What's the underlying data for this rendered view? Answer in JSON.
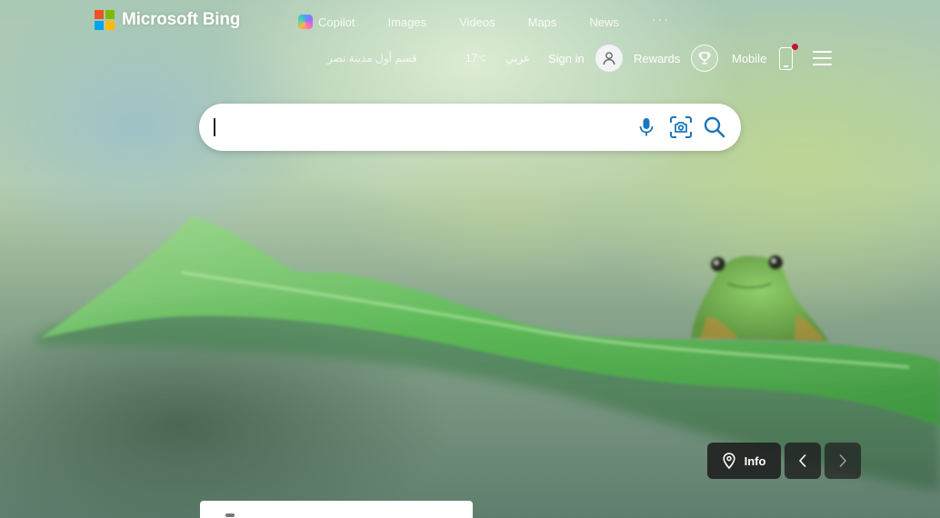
{
  "brand": {
    "name": "Microsoft Bing"
  },
  "nav": {
    "items": [
      {
        "label": "Copilot",
        "icon": "copilot-icon"
      },
      {
        "label": "Images"
      },
      {
        "label": "Videos"
      },
      {
        "label": "Maps"
      },
      {
        "label": "News"
      }
    ],
    "more_label": "···"
  },
  "header": {
    "quake_text": "قسم أول مدينة نصر",
    "temperature": "17",
    "temperature_unit": "℃",
    "language": "عربي",
    "signin_label": "Sign in",
    "rewards_label": "Rewards",
    "mobile_label": "Mobile"
  },
  "search": {
    "value": "",
    "placeholder": "",
    "icons": [
      "microphone-icon",
      "visual-search-icon",
      "search-icon"
    ]
  },
  "image_controls": {
    "info_label": "Info",
    "icons": [
      "location-pin-icon",
      "chevron-left-icon",
      "chevron-right-icon"
    ]
  },
  "colors": {
    "accent": "#1c76bc",
    "notification": "#c4122f",
    "overlay_button": "#1e1e1e"
  }
}
